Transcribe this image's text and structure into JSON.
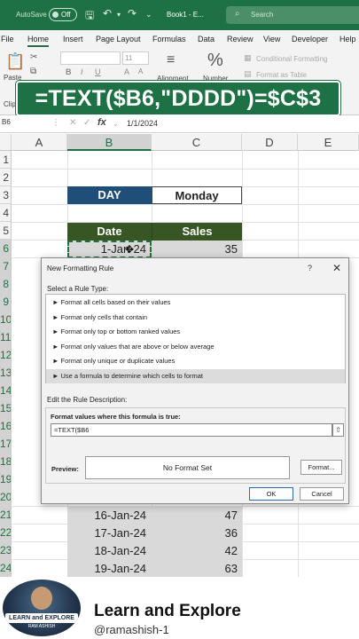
{
  "titlebar": {
    "autosave_label": "AutoSave",
    "autosave_state": "Off",
    "filename": "Book1 - E...",
    "search_placeholder": "Search"
  },
  "ribbon": {
    "tabs": [
      "File",
      "Home",
      "Insert",
      "Page Layout",
      "Formulas",
      "Data",
      "Review",
      "View",
      "Developer",
      "Help"
    ],
    "active_tab": "Home",
    "paste_label": "Paste",
    "clipboard_label": "Clipb",
    "font_size": "11",
    "alignment_label": "Alignment",
    "number_label": "Number",
    "conditional_formatting": "Conditional Formatting",
    "format_as_table": "Format as Table"
  },
  "banner_formula": "=TEXT($B6,\"DDDD\")=$C$3",
  "formula_bar": {
    "name_box": "B6",
    "value": "1/1/2024"
  },
  "grid": {
    "columns": [
      "A",
      "B",
      "C",
      "D",
      "E"
    ],
    "rows": [
      "1",
      "2",
      "3",
      "4",
      "5",
      "6",
      "7",
      "8",
      "9",
      "10",
      "11",
      "12",
      "13",
      "14",
      "15",
      "16",
      "17",
      "18",
      "19",
      "20",
      "21",
      "22",
      "23",
      "24"
    ],
    "day_label": "DAY",
    "day_value": "Monday",
    "header_date": "Date",
    "header_sales": "Sales",
    "top_row": {
      "date": "1-Jan-24",
      "sales": "35"
    },
    "bottom_rows": [
      {
        "date": "16-Jan-24",
        "sales": "47"
      },
      {
        "date": "17-Jan-24",
        "sales": "36"
      },
      {
        "date": "18-Jan-24",
        "sales": "42"
      },
      {
        "date": "19-Jan-24",
        "sales": "63"
      }
    ]
  },
  "dialog": {
    "title": "New Formatting Rule",
    "help": "?",
    "close": "✕",
    "select_rule_label": "Select a Rule Type:",
    "rule_types": [
      "► Format all cells based on their values",
      "► Format only cells that contain",
      "► Format only top or bottom ranked values",
      "► Format only values that are above or below average",
      "► Format only unique or duplicate values",
      "► Use a formula to determine which cells to format"
    ],
    "edit_label": "Edit the Rule Description:",
    "formula_label": "Format values where this formula is true:",
    "formula_value": "=TEXT($B6",
    "preview_label": "Preview:",
    "preview_text": "No Format Set",
    "format_button": "Format...",
    "ok_button": "OK",
    "cancel_button": "Cancel"
  },
  "footer": {
    "logo_text": "LEARN and EXPLORE",
    "logo_sub": "RAM ASHISH",
    "channel_name": "Learn and Explore",
    "handle": "@ramashish-1"
  }
}
